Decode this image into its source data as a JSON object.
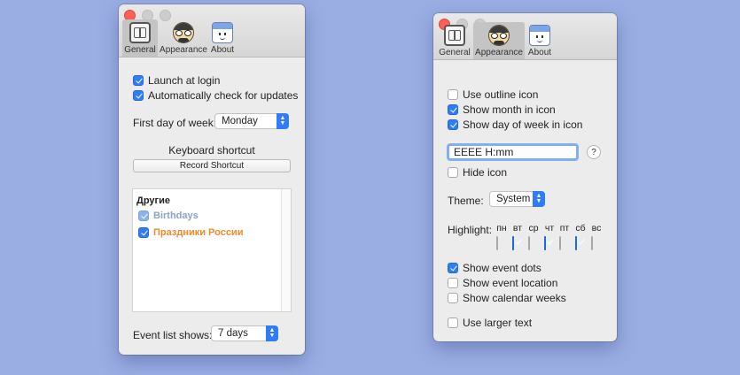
{
  "general_window": {
    "tabs": [
      {
        "label": "General",
        "icon": "general-icon",
        "selected": true
      },
      {
        "label": "Appearance",
        "icon": "appearance-icon",
        "selected": false
      },
      {
        "label": "About",
        "icon": "about-icon",
        "selected": false
      }
    ],
    "launch_at_login": {
      "label": "Launch at login",
      "checked": true
    },
    "auto_update": {
      "label": "Automatically check for updates",
      "checked": true
    },
    "first_day": {
      "label": "First day of week:",
      "value": "Monday"
    },
    "shortcut": {
      "heading": "Keyboard shortcut",
      "button": "Record Shortcut"
    },
    "calendars": {
      "group": "Другие",
      "items": [
        {
          "label": "Birthdays",
          "checked": true,
          "color": "#8aa3c7"
        },
        {
          "label": "Праздники России",
          "checked": true,
          "color": "#f0892a"
        }
      ]
    },
    "event_list": {
      "label": "Event list shows:",
      "value": "7 days"
    }
  },
  "appearance_window": {
    "tabs": [
      {
        "label": "General",
        "icon": "general-icon",
        "selected": false
      },
      {
        "label": "Appearance",
        "icon": "appearance-icon",
        "selected": true
      },
      {
        "label": "About",
        "icon": "about-icon",
        "selected": false
      }
    ],
    "outline_icon": {
      "label": "Use outline icon",
      "checked": false
    },
    "month_icon": {
      "label": "Show month in icon",
      "checked": true
    },
    "dow_icon": {
      "label": "Show day of week in icon",
      "checked": true
    },
    "format": {
      "value": "EEEE H:mm",
      "help": "?"
    },
    "hide_icon": {
      "label": "Hide icon",
      "checked": false
    },
    "theme": {
      "label": "Theme:",
      "value": "System"
    },
    "highlight": {
      "label": "Highlight:",
      "days": [
        "пн",
        "вт",
        "ср",
        "чт",
        "пт",
        "сб",
        "вс"
      ],
      "checked": [
        false,
        true,
        false,
        true,
        false,
        true,
        false
      ]
    },
    "event_dots": {
      "label": "Show event dots",
      "checked": true
    },
    "event_location": {
      "label": "Show event location",
      "checked": false
    },
    "calendar_weeks": {
      "label": "Show calendar weeks",
      "checked": false
    },
    "larger_text": {
      "label": "Use larger text",
      "checked": false
    }
  },
  "colors": {
    "accent": "#2f7cf6",
    "background": "#9aaee4"
  }
}
